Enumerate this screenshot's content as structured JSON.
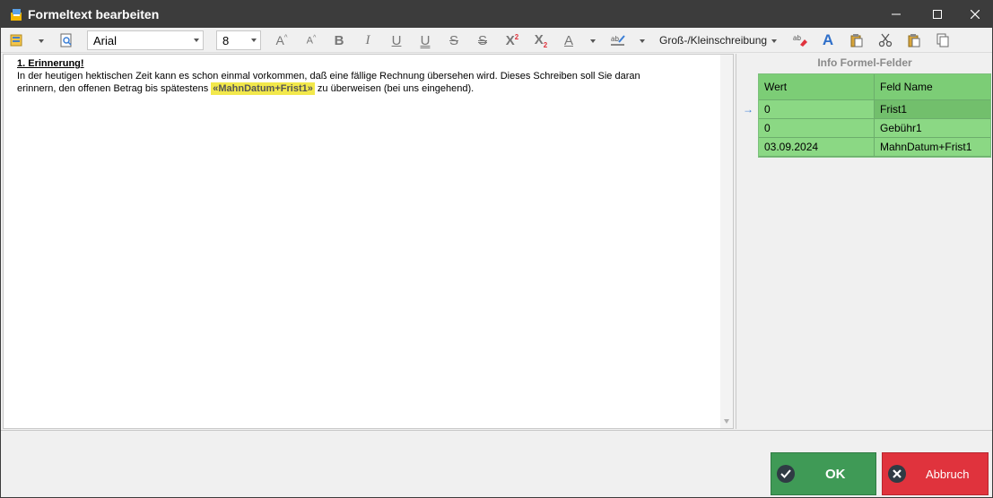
{
  "window": {
    "title": "Formeltext bearbeiten",
    "minimize": "—",
    "maximize": "☐",
    "close": "✕"
  },
  "toolbar": {
    "font_name": "Arial",
    "font_size": "8",
    "case_label": "Groß-/Kleinschreibung",
    "superscript": "X",
    "superscript_mark": "2",
    "subscript": "X",
    "subscript_mark": "2"
  },
  "editor": {
    "heading": "1. Erinnerung!",
    "line1": "In der heutigen hektischen Zeit kann es schon einmal vorkommen, daß eine fällige Rechnung übersehen wird. Dieses Schreiben soll Sie daran",
    "line2_before": "erinnern, den offenen Betrag bis spätestens ",
    "field": "«MahnDatum+Frist1»",
    "line2_after": " zu überweisen (bei uns eingehend)."
  },
  "info_panel": {
    "title": "Info Formel-Felder",
    "columns": [
      "Wert",
      "Feld Name"
    ],
    "rows": [
      {
        "wert": "0",
        "feld": "Frist1"
      },
      {
        "wert": "0",
        "feld": "Gebühr1"
      },
      {
        "wert": "03.09.2024",
        "feld": "MahnDatum+Frist1"
      }
    ]
  },
  "buttons": {
    "ok": "OK",
    "cancel": "Abbruch"
  },
  "colors": {
    "titlebar": "#3c3c3c",
    "ok": "#3f9a56",
    "cancel": "#e0333d",
    "grid": "#8bd884",
    "highlight": "#f2e84b"
  }
}
